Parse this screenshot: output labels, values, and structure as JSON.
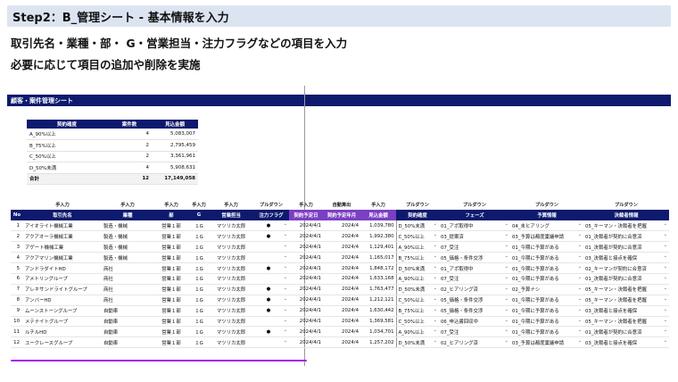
{
  "header": {
    "title": "Step2：B_管理シート - 基本情報を入力",
    "line1": "取引先名・業種・部・ G・営業担当・注力フラグなどの項目を入力",
    "line2": "必要に応じて項目の追加や削除を実施"
  },
  "sheet": {
    "title": "顧客・案件管理シート"
  },
  "summary": {
    "headers": [
      "契約確度",
      "案件数",
      "見込金額"
    ],
    "rows": [
      [
        "A_90%以上",
        "4",
        "5,083,007"
      ],
      [
        "B_75%以上",
        "2",
        "2,795,459"
      ],
      [
        "C_50%以上",
        "2",
        "3,361,961"
      ],
      [
        "D_50%未満",
        "4",
        "5,908,631"
      ]
    ],
    "total": [
      "合計",
      "12",
      "17,149,058"
    ]
  },
  "table": {
    "types": [
      "",
      "手入力",
      "手入力",
      "手入力",
      "手入力",
      "手入力",
      "プルダウン",
      "手入力",
      "自動算出",
      "手入力",
      "プルダウン",
      "プルダウン",
      "プルダウン",
      "プルダウン"
    ],
    "headers": [
      "No",
      "取引先名",
      "業種",
      "部",
      "G",
      "営業担当",
      "注力フラグ",
      "契約予定日",
      "契約予定年月",
      "見込金額",
      "契約確度",
      "フェーズ",
      "予算情報",
      "決裁者情報"
    ],
    "chevron": "⌄",
    "flag_symbol": "●",
    "rows": [
      [
        "1",
        "アイオライト機械工業",
        "製造・機械",
        "営業１部",
        "１G",
        "マツリカ太郎",
        true,
        "2024/4/1",
        "2024/4",
        "1,039,780",
        "D_50%未満",
        "01_アポ取得中",
        "04_未ヒアリング",
        "05_キーマン・決裁者を把握"
      ],
      [
        "2",
        "アクアオーラ機械工業",
        "製造・機械",
        "営業１部",
        "１G",
        "マツリカ太郎",
        true,
        "2024/4/1",
        "2024/4",
        "1,992,380",
        "C_50%以上",
        "03_提案済",
        "03_予算は都度稟議申請",
        "01_決裁者が契約に合意済"
      ],
      [
        "3",
        "アゲート機械工業",
        "製造・機械",
        "営業１部",
        "１G",
        "マツリカ太郎",
        false,
        "2024/4/1",
        "2024/4",
        "1,129,401",
        "A_90%以上",
        "07_受注",
        "01_今期に予算がある",
        "01_決裁者が契約に合意済"
      ],
      [
        "4",
        "アクアマリン機械工業",
        "製造・機械",
        "営業１部",
        "１G",
        "マツリカ太郎",
        false,
        "2024/4/1",
        "2024/4",
        "1,165,017",
        "B_75%以上",
        "05_価格・条件交渉",
        "01_今期に予算がある",
        "03_決裁者と接点を確保"
      ],
      [
        "5",
        "アンドラダイトHD",
        "商社",
        "営業１部",
        "１G",
        "マツリカ太郎",
        true,
        "2024/4/1",
        "2024/4",
        "1,848,172",
        "D_50%未満",
        "01_アポ取得中",
        "01_今期に予算がある",
        "02_キーマンが契約に合意済"
      ],
      [
        "6",
        "アメトリングループ",
        "商社",
        "営業１部",
        "１G",
        "マツリカ太郎",
        false,
        "2024/4/1",
        "2024/4",
        "1,633,168",
        "A_90%以上",
        "07_受注",
        "01_今期に予算がある",
        "01_決裁者が契約に合意済"
      ],
      [
        "7",
        "アレキサンドライトグループ",
        "商社",
        "営業１部",
        "１G",
        "マツリカ太郎",
        true,
        "2024/4/1",
        "2024/4",
        "1,763,477",
        "D_50%未満",
        "02_ヒアリング済",
        "02_予算ナシ",
        "05_キーマン・決裁者を把握"
      ],
      [
        "8",
        "アンバーHD",
        "商社",
        "営業１部",
        "１G",
        "マツリカ太郎",
        true,
        "2024/4/1",
        "2024/4",
        "1,212,121",
        "C_50%以上",
        "05_価格・条件交渉",
        "01_今期に予算がある",
        "05_キーマン・決裁者を把握"
      ],
      [
        "9",
        "ムーンストーングループ",
        "自動車",
        "営業１部",
        "１G",
        "マツリカ太郎",
        true,
        "2024/4/1",
        "2024/4",
        "1,630,442",
        "B_75%以上",
        "05_価格・条件交渉",
        "01_今期に予算がある",
        "03_決裁者と接点を確保"
      ],
      [
        "10",
        "メテナイトグループ",
        "自動車",
        "営業１部",
        "１G",
        "マツリカ太郎",
        false,
        "2024/4/1",
        "2024/4",
        "1,369,581",
        "C_50%以上",
        "06_申込書回収中",
        "01_今期に予算がある",
        "05_キーマン・決裁者を把握"
      ],
      [
        "11",
        "ルチルHD",
        "自動車",
        "営業１部",
        "１G",
        "マツリカ太郎",
        true,
        "2024/4/1",
        "2024/4",
        "1,034,701",
        "A_90%以上",
        "07_受注",
        "01_今期に予算がある",
        "01_決裁者が契約に合意済"
      ],
      [
        "12",
        "ユークレースグループ",
        "自動車",
        "営業１部",
        "１G",
        "マツリカ太郎",
        false,
        "2024/4/1",
        "2024/4",
        "1,257,202",
        "D_50%未満",
        "02_ヒアリング済",
        "03_予算は都度稟議申請",
        "03_決裁者と接点を確保"
      ]
    ]
  },
  "colors": {
    "header_navy": "#0d1a6e",
    "accent_purple": "#7b3fc4",
    "highlight_line": "#a020f0",
    "title_bg": "#dde4f1"
  }
}
